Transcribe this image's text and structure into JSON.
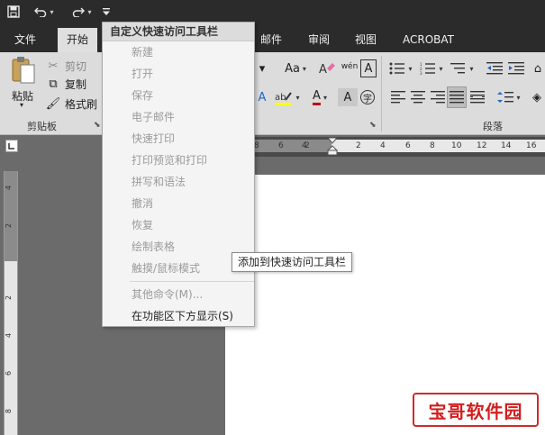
{
  "qat": {
    "save_icon": "save-icon",
    "undo_icon": "undo-icon",
    "redo_icon": "redo-icon",
    "customize_icon": "customize-dropdown-icon"
  },
  "tabs": [
    {
      "label": "文件"
    },
    {
      "label": "开始"
    },
    {
      "label": "邮件"
    },
    {
      "label": "审阅"
    },
    {
      "label": "视图"
    },
    {
      "label": "ACROBAT"
    }
  ],
  "ribbon": {
    "clipboard": {
      "paste_label": "粘贴",
      "cut_label": "剪切",
      "copy_label": "复制",
      "format_painter_label": "格式刷",
      "group_label": "剪贴板"
    },
    "paragraph": {
      "group_label": "段落"
    },
    "font": {
      "case_label": "Aa",
      "phonetic_label": "wén",
      "border_char_label": "A",
      "font_color_label": "A",
      "enclosed_char_label": "字"
    }
  },
  "ruler": {
    "h_ticks": [
      "8",
      "6",
      "4",
      "2",
      "2",
      "4",
      "6",
      "8",
      "10",
      "12",
      "14",
      "16"
    ],
    "v_ticks": [
      "4",
      "2",
      "2",
      "4",
      "6",
      "8"
    ]
  },
  "menu": {
    "header": "自定义快速访问工具栏",
    "items": [
      {
        "label": "新建"
      },
      {
        "label": "打开"
      },
      {
        "label": "保存"
      },
      {
        "label": "电子邮件"
      },
      {
        "label": "快速打印"
      },
      {
        "label": "打印预览和打印"
      },
      {
        "label": "拼写和语法"
      },
      {
        "label": "撤消"
      },
      {
        "label": "恢复"
      },
      {
        "label": "绘制表格"
      },
      {
        "label": "触摸/鼠标模式"
      }
    ],
    "more_commands": "其他命令(M)...",
    "show_below": "在功能区下方显示(S)"
  },
  "tooltip": "添加到快速访问工具栏",
  "watermark": "宝哥软件园",
  "colors": {
    "dark_bar": "#2b2b2b",
    "ribbon_bg": "#dcdcdc",
    "menu_bg": "#f4f4f4",
    "font_color_red": "#c00000",
    "watermark_red": "#d11f1f"
  }
}
